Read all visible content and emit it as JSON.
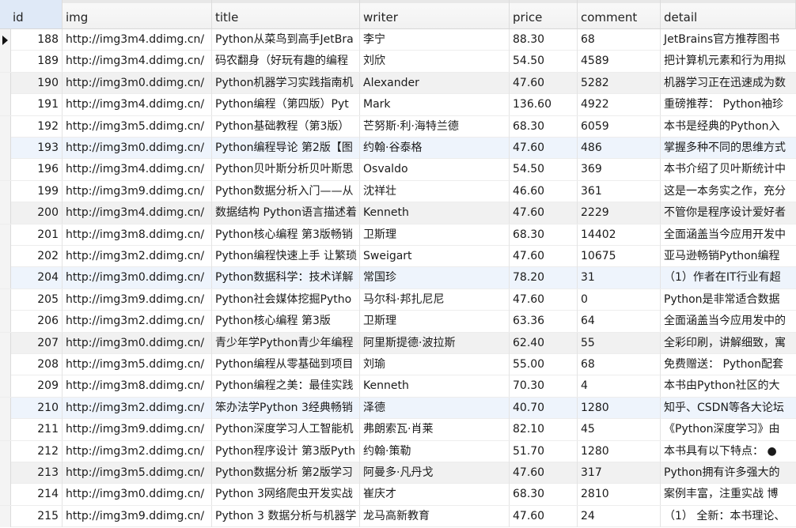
{
  "columns": [
    "id",
    "img",
    "title",
    "writer",
    "price",
    "comment",
    "detail"
  ],
  "rows": [
    {
      "id": "188",
      "img": "http://img3m4.ddimg.cn/",
      "title": "Python从菜鸟到高手JetBra",
      "writer": "李宁",
      "price": "88.30",
      "comment": "68",
      "detail": "JetBrains官方推荐图书"
    },
    {
      "id": "189",
      "img": "http://img3m4.ddimg.cn/",
      "title": "码农翻身（好玩有趣的编程",
      "writer": "刘欣",
      "price": "54.50",
      "comment": "4589",
      "detail": "把计算机元素和行为用拟"
    },
    {
      "id": "190",
      "img": "http://img3m0.ddimg.cn/",
      "title": "Python机器学习实践指南机",
      "writer": "Alexander",
      "price": "47.60",
      "comment": "5282",
      "detail": "机器学习正在迅速成为数"
    },
    {
      "id": "191",
      "img": "http://img3m4.ddimg.cn/",
      "title": "Python编程（第四版）Pyt",
      "writer": "Mark",
      "price": "136.60",
      "comment": "4922",
      "detail": "重磅推荐： Python袖珍"
    },
    {
      "id": "192",
      "img": "http://img3m5.ddimg.cn/",
      "title": "Python基础教程（第3版）",
      "writer": "芒努斯·利·海特兰德",
      "price": "68.30",
      "comment": "6059",
      "detail": "本书是经典的Python入"
    },
    {
      "id": "193",
      "img": "http://img3m0.ddimg.cn/",
      "title": "Python编程导论 第2版【图",
      "writer": "约翰·谷泰格",
      "price": "47.60",
      "comment": "486",
      "detail": "掌握多种不同的思维方式"
    },
    {
      "id": "196",
      "img": "http://img3m4.ddimg.cn/",
      "title": "Python贝叶斯分析贝叶斯思",
      "writer": "Osvaldo",
      "price": "54.50",
      "comment": "369",
      "detail": "本书介绍了贝叶斯统计中"
    },
    {
      "id": "199",
      "img": "http://img3m9.ddimg.cn/",
      "title": "Python数据分析入门——从",
      "writer": "沈祥壮",
      "price": "46.60",
      "comment": "361",
      "detail": "这是一本务实之作，充分"
    },
    {
      "id": "200",
      "img": "http://img3m4.ddimg.cn/",
      "title": "数据结构 Python语言描述着",
      "writer": "Kenneth",
      "price": "47.60",
      "comment": "2229",
      "detail": "不管你是程序设计爱好者"
    },
    {
      "id": "201",
      "img": "http://img3m8.ddimg.cn/",
      "title": "Python核心编程 第3版畅销",
      "writer": "卫斯理",
      "price": "68.30",
      "comment": "14402",
      "detail": "全面涵盖当今应用开发中"
    },
    {
      "id": "202",
      "img": "http://img3m2.ddimg.cn/",
      "title": "Python编程快速上手 让繁琐",
      "writer": "Sweigart",
      "price": "47.60",
      "comment": "10675",
      "detail": "亚马逊畅销Python编程"
    },
    {
      "id": "204",
      "img": "http://img3m0.ddimg.cn/",
      "title": "Python数据科学：技术详解",
      "writer": "常国珍",
      "price": "78.20",
      "comment": "31",
      "detail": "（1）作者在IT行业有超"
    },
    {
      "id": "205",
      "img": "http://img3m9.ddimg.cn/",
      "title": "Python社会媒体挖掘Pytho",
      "writer": "马尔科·邦扎尼尼",
      "price": "47.60",
      "comment": "0",
      "detail": "Python是非常适合数据"
    },
    {
      "id": "206",
      "img": "http://img3m2.ddimg.cn/",
      "title": "Python核心编程 第3版",
      "writer": "卫斯理",
      "price": "63.36",
      "comment": "64",
      "detail": "全面涵盖当今应用发中的"
    },
    {
      "id": "207",
      "img": "http://img3m0.ddimg.cn/",
      "title": "青少年学Python青少年编程",
      "writer": "阿里斯提德·波拉斯",
      "price": "62.40",
      "comment": "55",
      "detail": "全彩印刷，讲解细致，寓"
    },
    {
      "id": "208",
      "img": "http://img3m5.ddimg.cn/",
      "title": "Python编程从零基础到项目",
      "writer": "刘瑜",
      "price": "55.00",
      "comment": "68",
      "detail": "免费赠送： Python配套"
    },
    {
      "id": "209",
      "img": "http://img3m8.ddimg.cn/",
      "title": "Python编程之美：最佳实践",
      "writer": "Kenneth",
      "price": "70.30",
      "comment": "4",
      "detail": "本书由Python社区的大"
    },
    {
      "id": "210",
      "img": "http://img3m2.ddimg.cn/",
      "title": "笨办法学Python 3经典畅销",
      "writer": "泽德",
      "price": "40.70",
      "comment": "1280",
      "detail": "知乎、CSDN等各大论坛"
    },
    {
      "id": "211",
      "img": "http://img3m9.ddimg.cn/",
      "title": "Python深度学习人工智能机",
      "writer": "弗朗索瓦·肖莱",
      "price": "82.10",
      "comment": "45",
      "detail": "《Python深度学习》由"
    },
    {
      "id": "212",
      "img": "http://img3m2.ddimg.cn/",
      "title": "Python程序设计 第3版Pyth",
      "writer": "约翰·策勒",
      "price": "51.70",
      "comment": "1280",
      "detail": "本书具有以下特点： ●"
    },
    {
      "id": "213",
      "img": "http://img3m5.ddimg.cn/",
      "title": "Python数据分析 第2版学习",
      "writer": "阿曼多·凡丹戈",
      "price": "47.60",
      "comment": "317",
      "detail": "Python拥有许多强大的"
    },
    {
      "id": "214",
      "img": "http://img3m0.ddimg.cn/",
      "title": "Python 3网络爬虫开发实战",
      "writer": "崔庆才",
      "price": "68.30",
      "comment": "2810",
      "detail": "案例丰富，注重实战 博"
    },
    {
      "id": "215",
      "img": "http://img3m9.ddimg.cn/",
      "title": "Python 3 数据分析与机器学",
      "writer": "龙马高新教育",
      "price": "47.60",
      "comment": "24",
      "detail": "（1） 全新：本书理论、"
    }
  ]
}
